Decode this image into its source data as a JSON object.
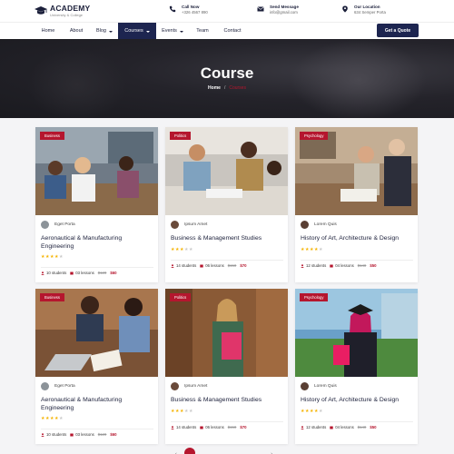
{
  "brand": {
    "name": "ACADEMY",
    "tagline": "University & College"
  },
  "contacts": [
    {
      "icon": "phone-icon",
      "title": "Call Now",
      "value": "+326 4567 890"
    },
    {
      "icon": "mail-icon",
      "title": "Send Message",
      "value": "info@gmail.com"
    },
    {
      "icon": "location-icon",
      "title": "Our Location",
      "value": "634 Semper Porta"
    }
  ],
  "nav": {
    "items": [
      {
        "label": "Home",
        "dropdown": false
      },
      {
        "label": "About",
        "dropdown": false
      },
      {
        "label": "Blog",
        "dropdown": true
      },
      {
        "label": "Courses",
        "dropdown": true,
        "active": true
      },
      {
        "label": "Events",
        "dropdown": true
      },
      {
        "label": "Team",
        "dropdown": false
      },
      {
        "label": "Contact",
        "dropdown": false
      }
    ],
    "cta_label": "Get a Quote"
  },
  "hero": {
    "title": "Course",
    "breadcrumb": {
      "home": "Home",
      "separator": "/",
      "current": "Courses"
    }
  },
  "colors": {
    "brand_navy": "#1d2550",
    "accent_red": "#b5162e",
    "star": "#f5b301"
  },
  "courses": [
    {
      "category": "Business",
      "author": "Eget Porta",
      "title": "Aeronautical & Manufacturing Engineering",
      "rating": 4,
      "students": "10 students",
      "lessons": "03 lessons",
      "old_price": "$120",
      "price": "$60"
    },
    {
      "category": "Politics",
      "author": "Ipsum Amet",
      "title": "Business & Management Studies",
      "rating": 3,
      "students": "14 students",
      "lessons": "06 lessons",
      "old_price": "$150",
      "price": "$70"
    },
    {
      "category": "Psychology",
      "author": "Lorem Quis",
      "title": "History of Art, Architecture & Design",
      "rating": 4,
      "students": "12 students",
      "lessons": "04 lessons",
      "old_price": "$140",
      "price": "$50"
    },
    {
      "category": "Business",
      "author": "Eget Porta",
      "title": "Aeronautical & Manufacturing Engineering",
      "rating": 4,
      "students": "10 students",
      "lessons": "03 lessons",
      "old_price": "$120",
      "price": "$60"
    },
    {
      "category": "Politics",
      "author": "Ipsum Amet",
      "title": "Business & Management Studies",
      "rating": 3,
      "students": "14 students",
      "lessons": "06 lessons",
      "old_price": "$150",
      "price": "$70"
    },
    {
      "category": "Psychology",
      "author": "Lorem Quis",
      "title": "History of Art, Architecture & Design",
      "rating": 4,
      "students": "12 students",
      "lessons": "04 lessons",
      "old_price": "$140",
      "price": "$50"
    }
  ]
}
